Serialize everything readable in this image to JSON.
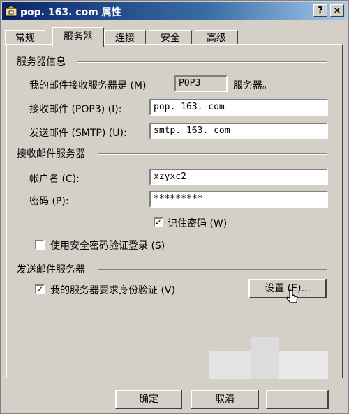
{
  "window": {
    "title": "pop. 163. com 属性",
    "help_btn": "?",
    "close_btn": "×"
  },
  "tabs": [
    {
      "label": "常规"
    },
    {
      "label": "服务器"
    },
    {
      "label": "连接"
    },
    {
      "label": "安全"
    },
    {
      "label": "高级"
    }
  ],
  "server_info": {
    "heading": "服务器信息",
    "incoming_type_label": "我的邮件接收服务器是 (M)",
    "incoming_type_value": "POP3",
    "incoming_type_suffix": "服务器。",
    "incoming_label": "接收邮件 (POP3) (I):",
    "incoming_value": "pop. 163. com",
    "outgoing_label": "发送邮件 (SMTP) (U):",
    "outgoing_value": "smtp. 163. com"
  },
  "incoming_server": {
    "heading": "接收邮件服务器",
    "account_label": "帐户名 (C):",
    "account_value": "xzyxc2",
    "password_label": "密码 (P):",
    "password_value": "*********",
    "remember_label": "记住密码 (W)",
    "remember_checked": true,
    "spa_label": "使用安全密码验证登录 (S)",
    "spa_checked": false
  },
  "outgoing_server": {
    "heading": "发送邮件服务器",
    "auth_label": "我的服务器要求身份验证 (V)",
    "auth_checked": true,
    "settings_button": "设置 (E)..."
  },
  "footer": {
    "ok_button": "确定",
    "cancel_button": "取消"
  }
}
